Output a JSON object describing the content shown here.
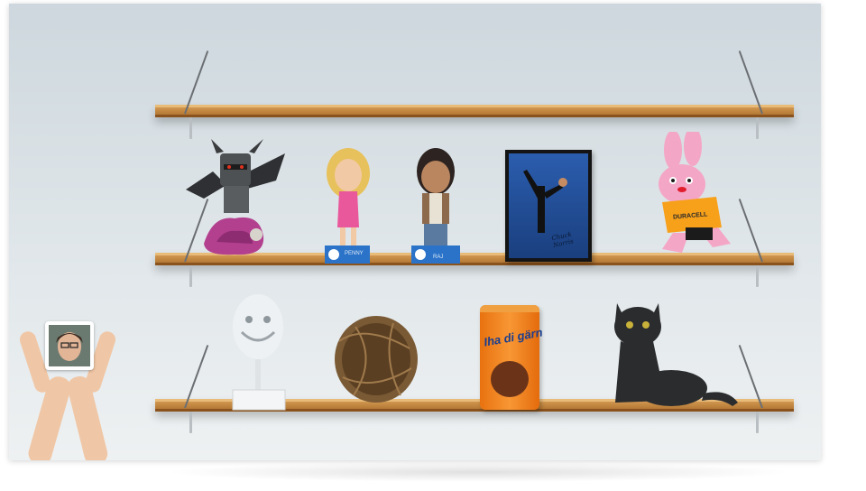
{
  "figures": {
    "penny_label": "PENNY",
    "raj_label": "RAJ"
  },
  "poster": {
    "signature_text": "Chuck Norris"
  },
  "drink": {
    "brand_text": "Iha di gärn"
  },
  "bunny": {
    "shirt_text": "DURACELL"
  },
  "colors": {
    "wall_top": "#cdd7dd",
    "wall_bottom": "#eef1f2",
    "shelf_wood": "#c58a43",
    "drink_orange": "#f07c1a",
    "bunny_pink": "#f4a6c6",
    "poster_blue": "#1f4f9e"
  }
}
